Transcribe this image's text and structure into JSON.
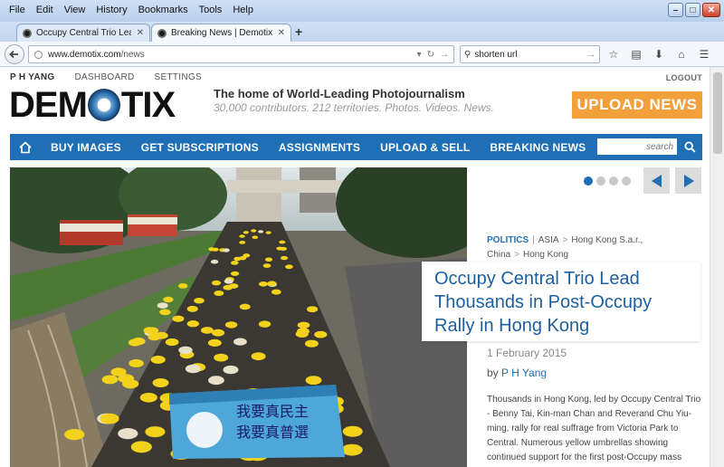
{
  "browser": {
    "menu": [
      "File",
      "Edit",
      "View",
      "History",
      "Bookmarks",
      "Tools",
      "Help"
    ],
    "tabs": [
      {
        "title": "Occupy Central Trio Lead Tho...",
        "active": false
      },
      {
        "title": "Breaking News | Demotix.com",
        "active": true
      }
    ],
    "url_host": "www.demotix.com",
    "url_path": "/news",
    "search_value": "shorten url"
  },
  "site": {
    "user": "P H YANG",
    "user_links": [
      "DASHBOARD",
      "SETTINGS"
    ],
    "logout": "LOGOUT",
    "logo_left": "DEM",
    "logo_right": "TIX",
    "tagline": "The home of World-Leading Photojournalism",
    "subtag": "30,000 contributors. 212 territories. Photos. Videos. News.",
    "upload_label": "UPLOAD NEWS",
    "nav": [
      "BUY IMAGES",
      "GET SUBSCRIPTIONS",
      "ASSIGNMENTS",
      "UPLOAD & SELL",
      "BREAKING NEWS"
    ],
    "search_placeholder": "search",
    "accent": "#1e6fb6",
    "upload_color": "#f3a03a"
  },
  "slider": {
    "dot_count": 4,
    "active_dot": 1
  },
  "story": {
    "category": "POLITICS",
    "crumbs": [
      "ASIA",
      "Hong Kong S.a.r., China",
      "Hong Kong"
    ],
    "title": "Occupy Central Trio Lead Thousands in Post-Occupy Rally in Hong Kong",
    "date": "1 February 2015",
    "by_label": "by",
    "author": "P H Yang",
    "body": "Thousands in Hong Kong, led by Occupy Central Trio - Benny Tai, Kin-man Chan and Reverand Chu Yiu-ming, rally for real suffrage from Victoria Park to Central. Numerous yellow umbrellas showing continued support for the first post-Occupy mass rally."
  },
  "hero": {
    "banner_line1": "我要真民主",
    "banner_line2": "我要真普選"
  }
}
